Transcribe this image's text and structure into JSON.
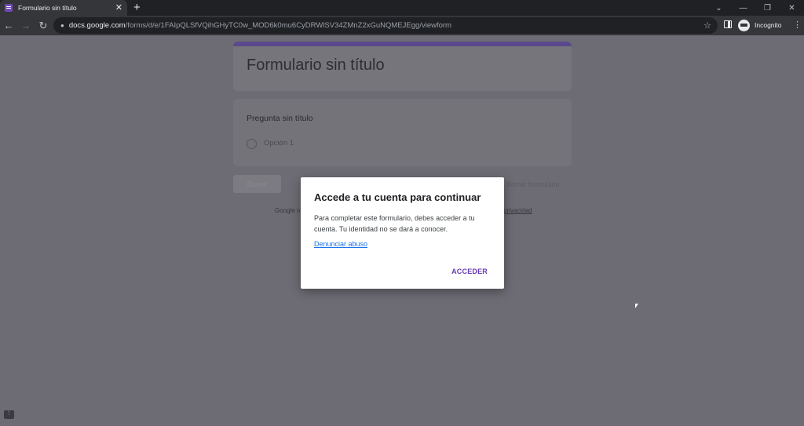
{
  "browser": {
    "tab_title": "Formulario sin título",
    "tab_close": "✕",
    "new_tab": "+",
    "window_controls": [
      "⌄",
      "—",
      "❐",
      "✕"
    ],
    "nav": {
      "back": "←",
      "forward": "→",
      "reload": "↻"
    },
    "url_host": "docs.google.com",
    "url_path": "/forms/d/e/1FAIpQLSfVQihGHyTC0w_MOD6k0mu6CyDRWlSV34ZMnZ2xGuNQMEJEgg/viewform",
    "incognito_label": "Incognito",
    "menu": "⋮",
    "star": "☆",
    "lock": "🔒"
  },
  "form": {
    "title": "Formulario sin título",
    "question": "Pregunta sin título",
    "option": "Opción 1",
    "submit_label": "Enviar",
    "clear_label": "Borrar formulario",
    "footer_text": "Google n",
    "footer_link": "privacidad"
  },
  "dialog": {
    "title": "Accede a tu cuenta para continuar",
    "body": "Para completar este formulario, debes acceder a tu cuenta. Tu identidad no se dará a conocer.",
    "report_link": "Denunciar abuso",
    "signin_button": "ACCEDER"
  },
  "colors": {
    "accent": "#673ab7",
    "link": "#1a73e8"
  }
}
